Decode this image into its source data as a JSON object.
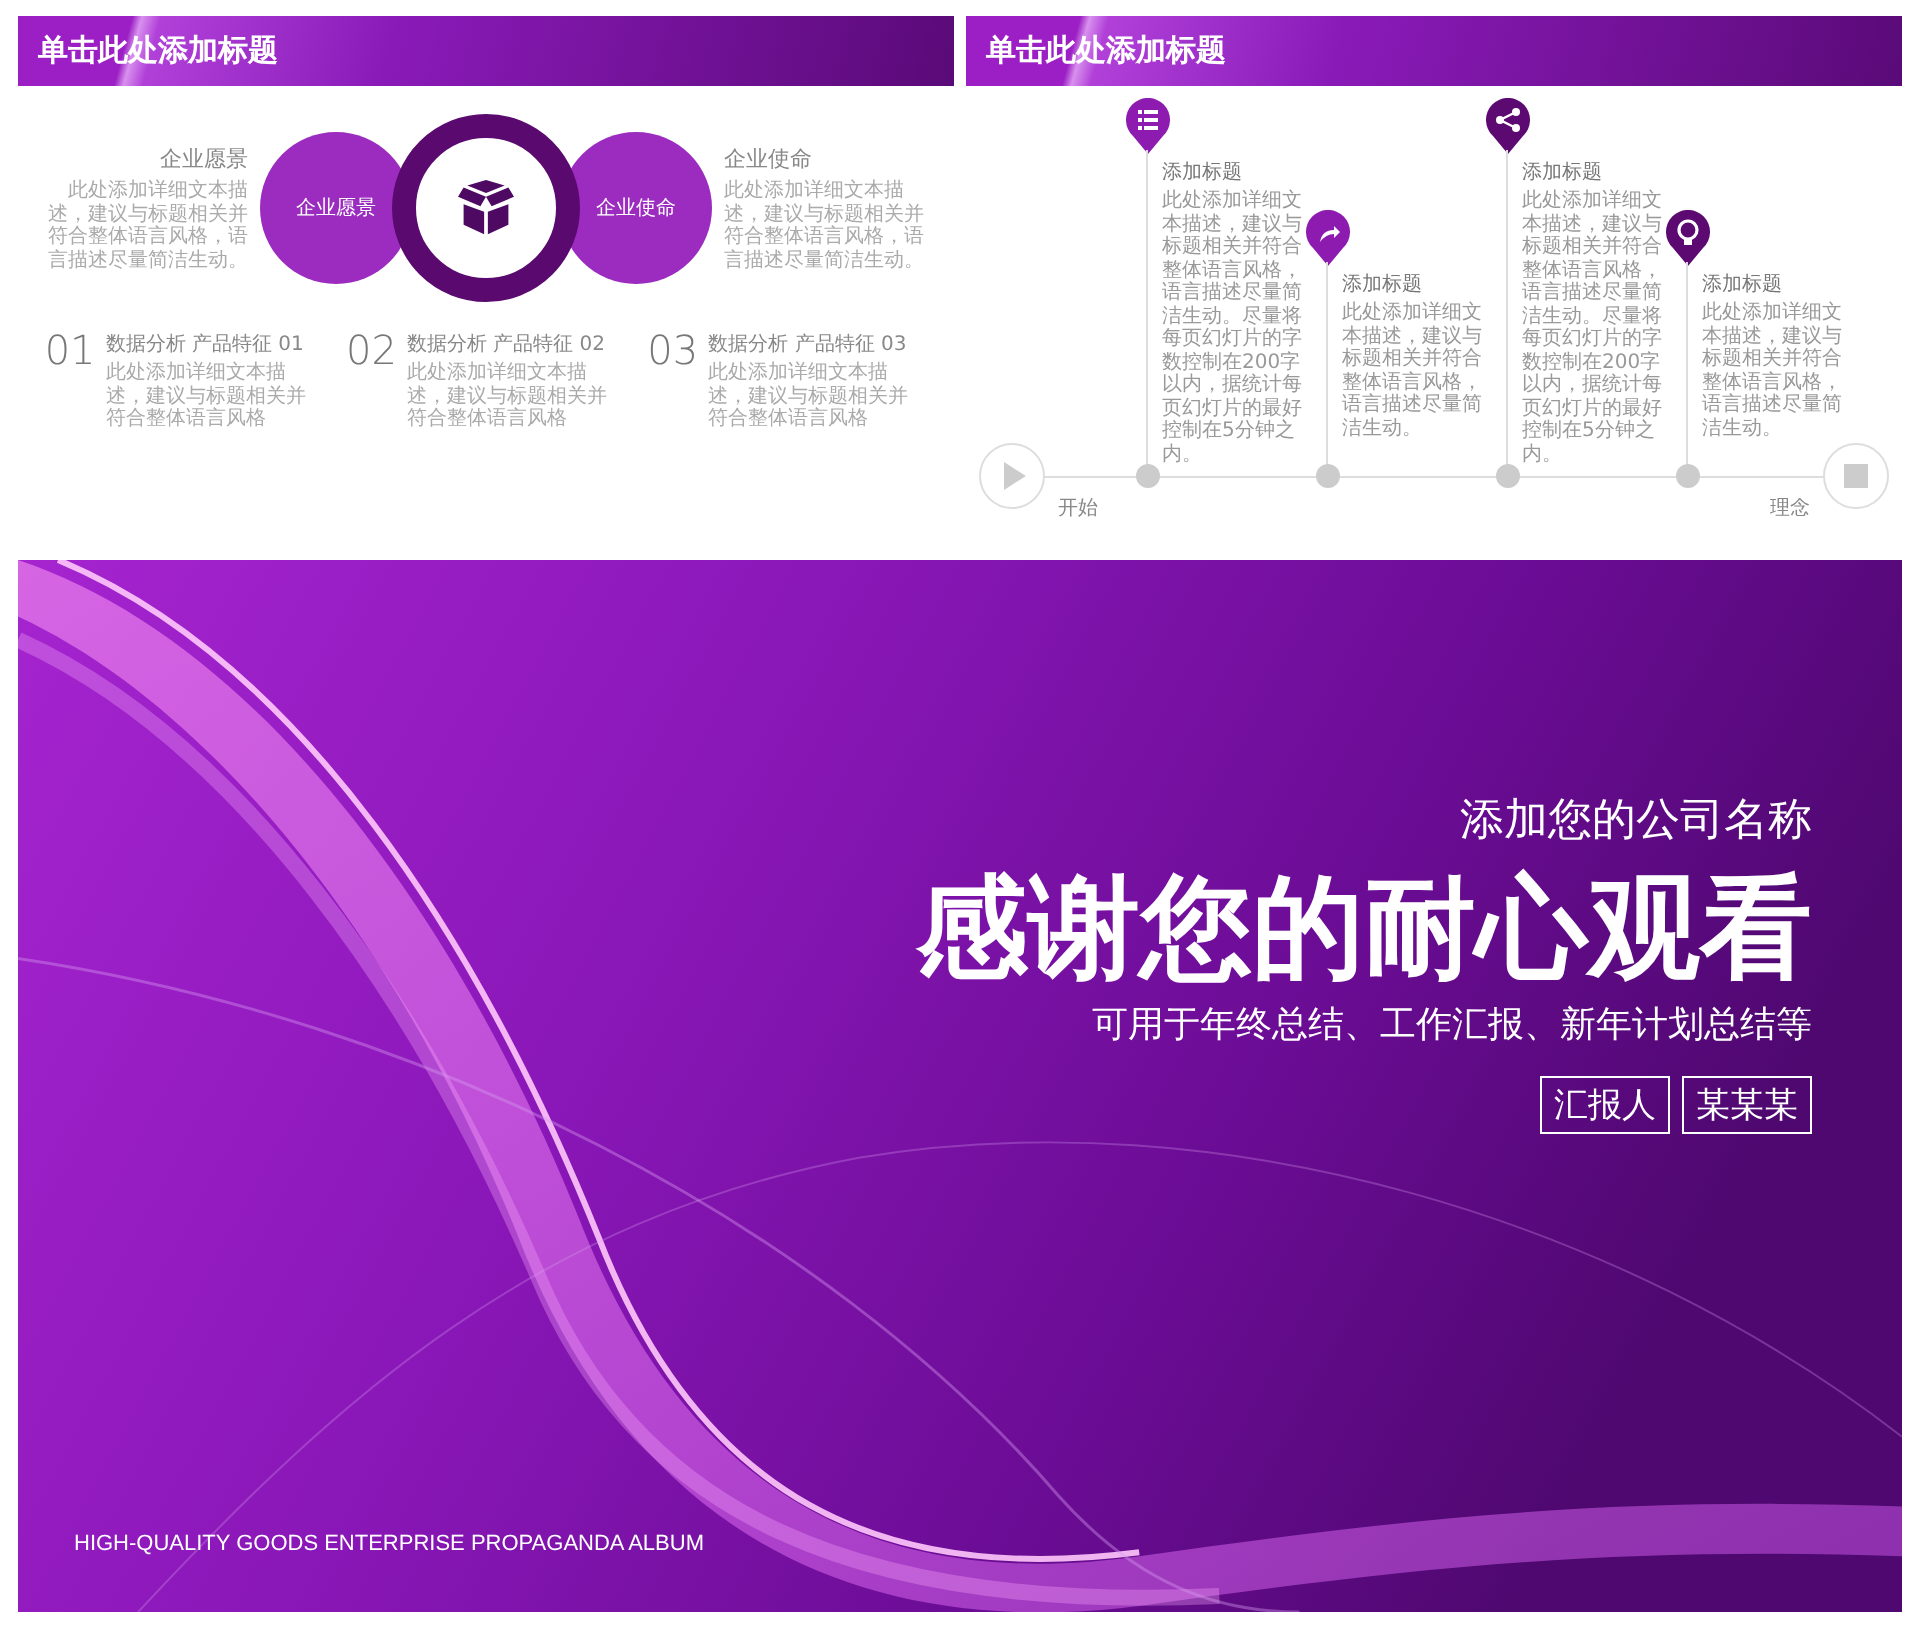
{
  "vision_slide": {
    "title": "单击此处添加标题",
    "side_notes": [
      {
        "heading": "企业愿景",
        "body": "此处添加详细文本描述，建议与标题相关并符合整体语言风格，语言描述尽量简洁生动。"
      },
      {
        "heading": "企业使命",
        "body": "此处添加详细文本描述，建议与标题相关并符合整体语言风格，语言描述尽量简洁生动。"
      }
    ],
    "circle_labels": [
      "企业愿景",
      "企业使命"
    ],
    "features": [
      {
        "number": "01",
        "heading": "数据分析 产品特征 01",
        "body": "此处添加详细文本描述，建议与标题相关并符合整体语言风格"
      },
      {
        "number": "02",
        "heading": "数据分析 产品特征 02",
        "body": "此处添加详细文本描述，建议与标题相关并符合整体语言风格"
      },
      {
        "number": "03",
        "heading": "数据分析 产品特征 03",
        "body": "此处添加详细文本描述，建议与标题相关并符合整体语言风格"
      }
    ]
  },
  "timeline_slide": {
    "title": "单击此处添加标题",
    "start_label": "开始",
    "end_label": "理念",
    "milestones": [
      {
        "kind": "high",
        "color": "#8e1bb0",
        "title": "添加标题",
        "body": "此处添加详细文本描述，建议与标题相关并符合整体语言风格，语言描述尽量简洁生动。尽量将每页幻灯片的字数控制在200字以内，据统计每页幻灯片的最好控制在5分钟之内。"
      },
      {
        "kind": "low",
        "color": "#8e1bb0",
        "title": "添加标题",
        "body": "此处添加详细文本描述，建议与标题相关并符合整体语言风格，语言描述尽量简洁生动。"
      },
      {
        "kind": "high",
        "color": "#5c0a72",
        "title": "添加标题",
        "body": "此处添加详细文本描述，建议与标题相关并符合整体语言风格，语言描述尽量简洁生动。尽量将每页幻灯片的字数控制在200字以内，据统计每页幻灯片的最好控制在5分钟之内。"
      },
      {
        "kind": "low",
        "color": "#5c0a72",
        "title": "添加标题",
        "body": "此处添加详细文本描述，建议与标题相关并符合整体语言风格，语言描述尽量简洁生动。"
      }
    ]
  },
  "closing_slide": {
    "company": "添加您的公司名称",
    "title": "感谢您的耐心观看",
    "subtitle": "可用于年终总结、工作汇报、新年计划总结等",
    "presenter_label": "汇报人",
    "presenter_name": "某某某",
    "tagline": "HIGH-QUALITY GOODS ENTERPRISE PROPAGANDA ALBUM"
  }
}
